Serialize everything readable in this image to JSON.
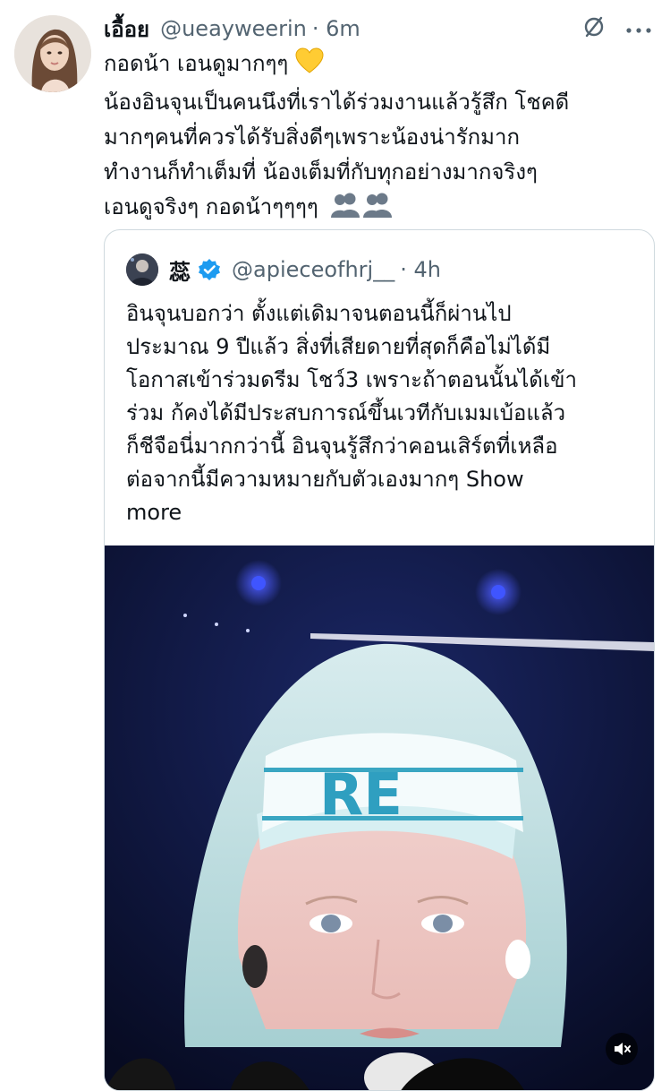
{
  "tweet": {
    "author_name": "เอื้อย",
    "author_handle": "@ueayweerin",
    "time": "· 6m",
    "text": "กอดน้า เอนดูมากๆๆ ",
    "text_rest": "\nน้องอินจุนเป็นคนนึงที่เราได้ร่วมงานแล้วรู้สึก โชคดี\nมากๆคนที่ควรได้รับสิ่งดีๆเพราะน้องน่ารักมาก\nทำงานก็ทำเต็มที่ น้องเต็มที่กับทุกอย่างมากจริงๆ\nเอนดูจริงๆ  กอดน้าๆๆๆๆ ",
    "icons": [
      "no-reply-icon",
      "more-icon",
      "yellow-heart-emoji",
      "busts-emoji"
    ]
  },
  "quote": {
    "author_name": "蕊",
    "author_handle": "@apieceofhrj__",
    "time": "· 4h",
    "text": "อินจุนบอกว่า ตั้งแต่เดิมาจนตอนนี้ก็ผ่านไป\nประมาณ 9 ปีแล้ว สิ่งที่เสียดายที่สุดก็คือไม่ได้มี\nโอกาสเข้าร่วมดรีม โชว์3 เพราะถ้าตอนนั้นได้เข้า\nร่วม ก้คงได้มีประสบการณ์ขึ้นเวทีกับเมมเบ้อแล้ว\nก็ชีจือนี่มากกว่านี้ อินจุนรู้สึกว่าคอนเสิร์ตที่เหลือ\nต่อจากนี้มีความหมายกับตัวเองมากๆ ",
    "show_more": "Show\nmore",
    "headband_text": "RE",
    "icons": [
      "verified-badge-icon",
      "muted-volume-icon"
    ]
  },
  "colors": {
    "text": "#0f1419",
    "secondary": "#536471",
    "border": "#cfd9de",
    "verified": "#1d9bf0"
  }
}
